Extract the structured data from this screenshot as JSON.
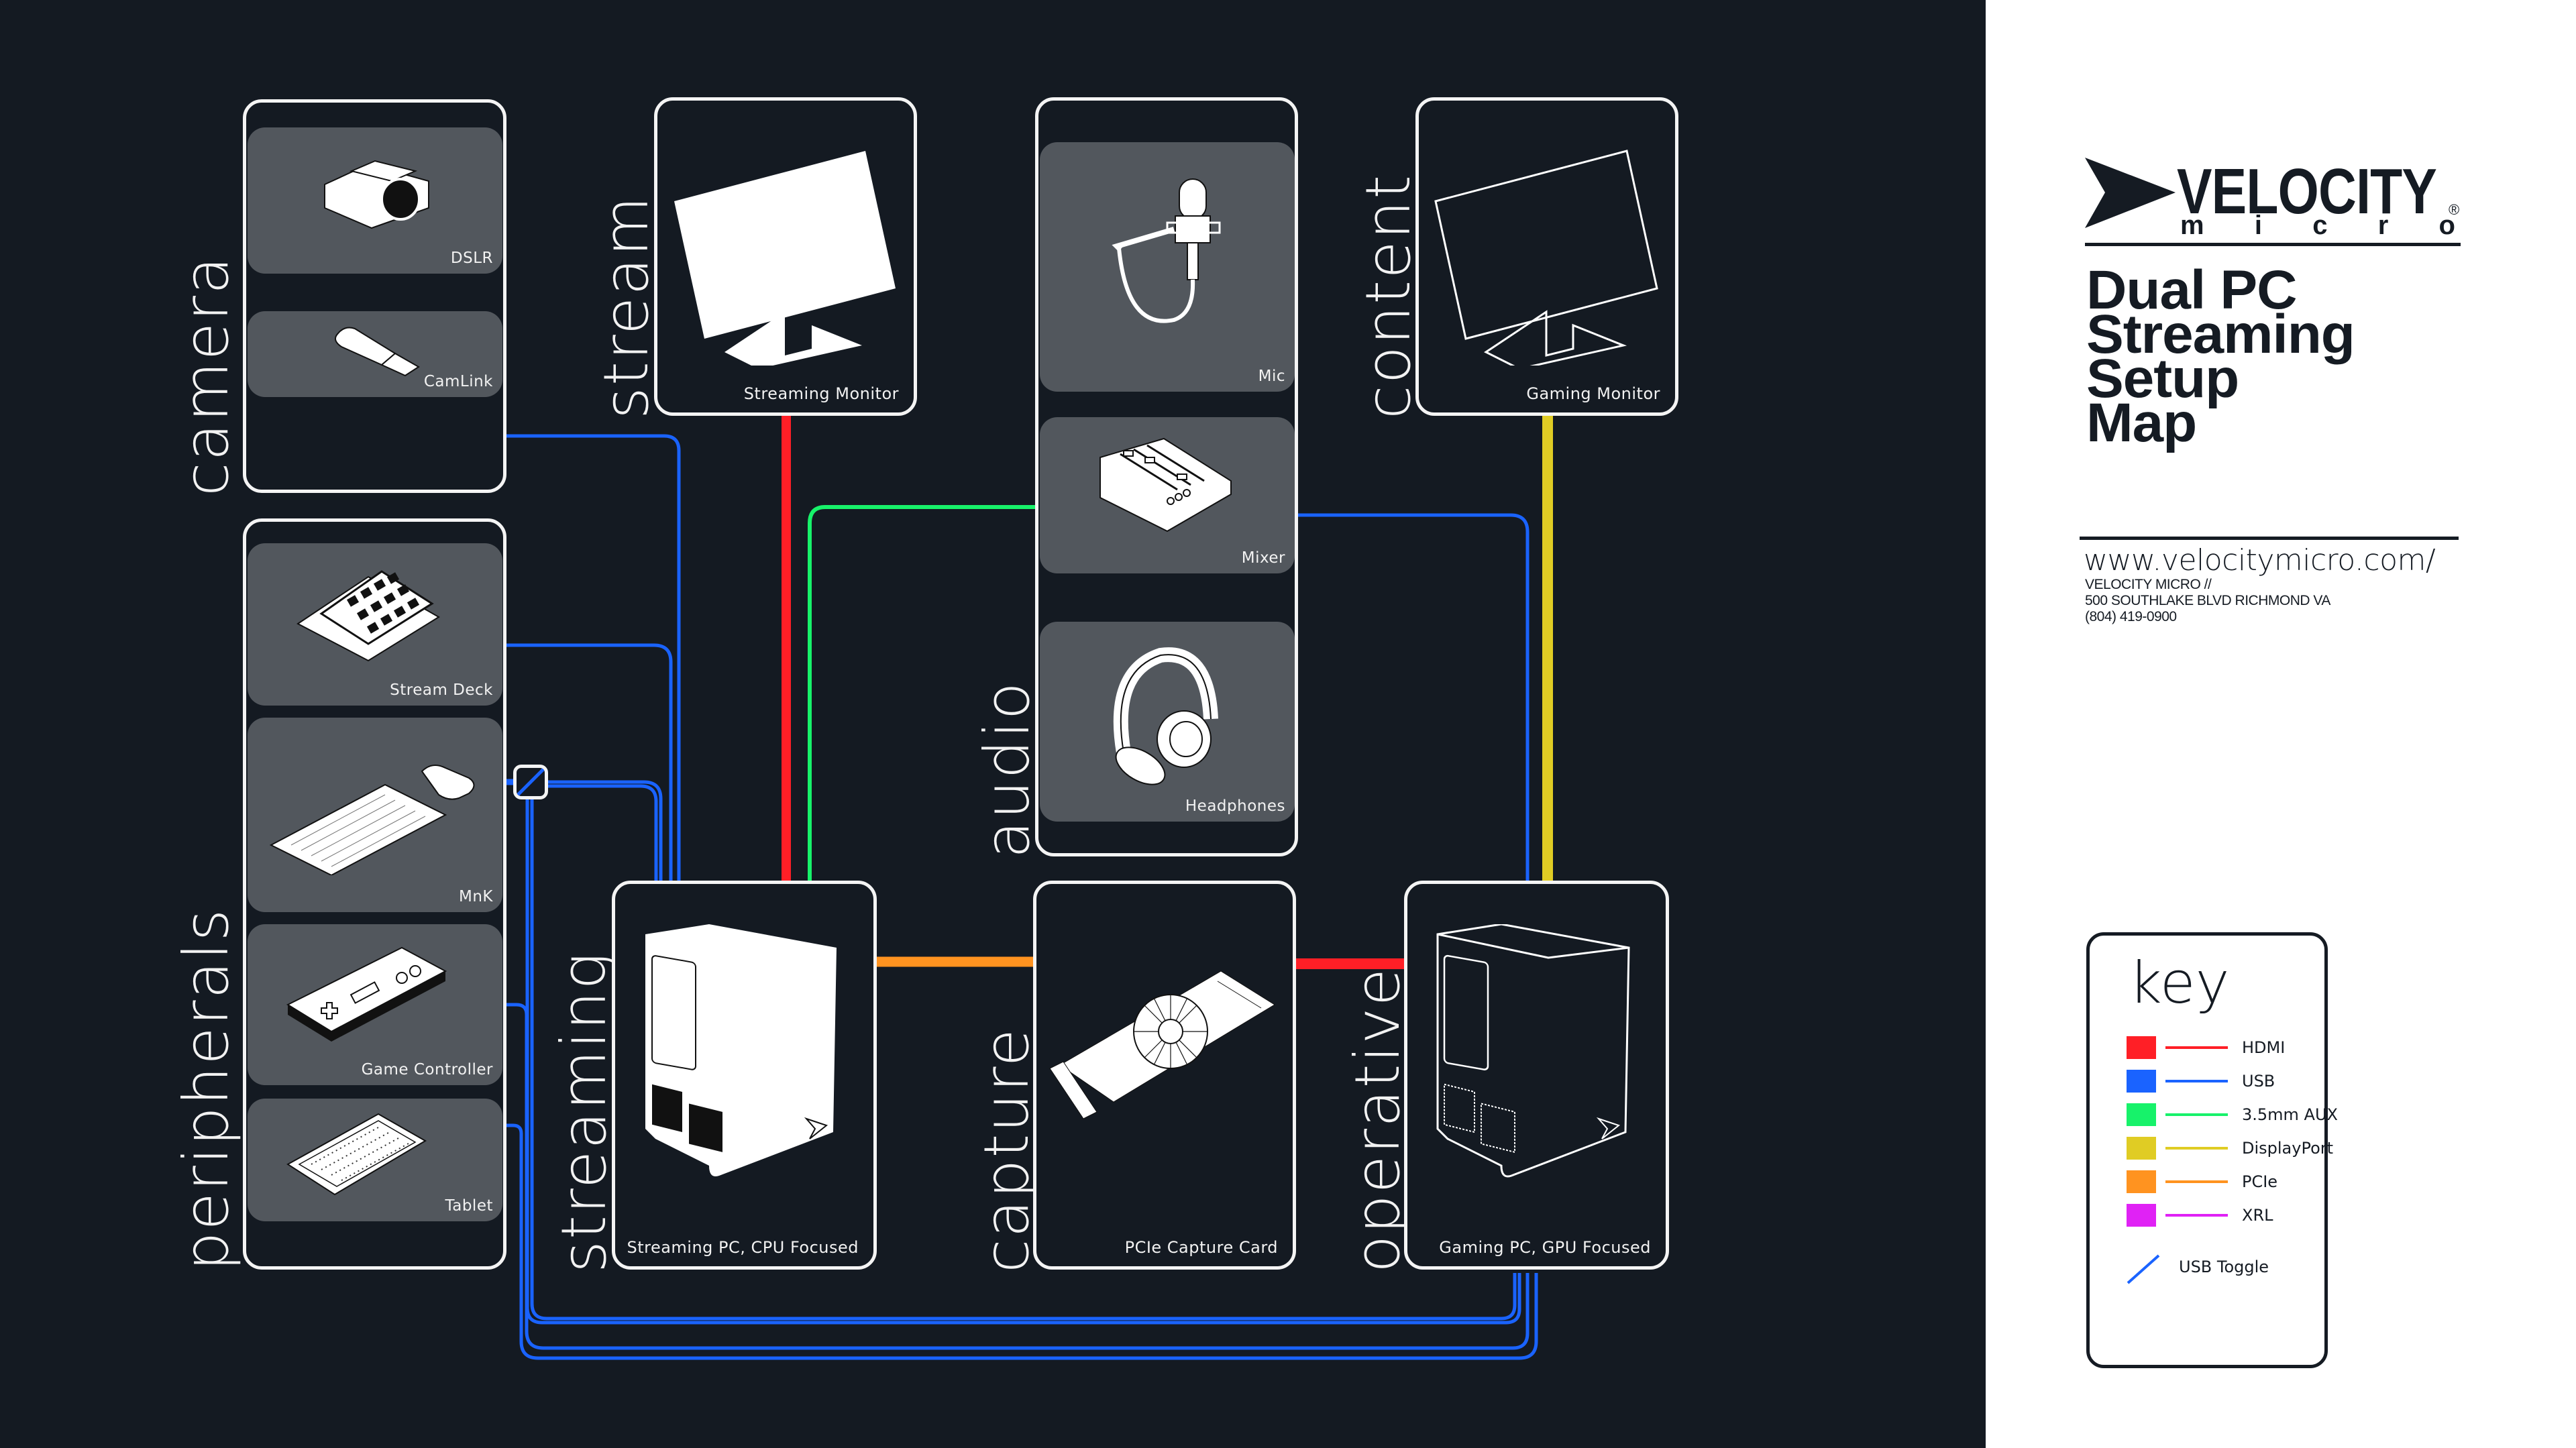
{
  "colors": {
    "background_dark": "#141a22",
    "panel_light": "#ffffff",
    "tile": "#52575d",
    "hdmi": "#ff1f26",
    "usb": "#1a63ff",
    "aux": "#17f26a",
    "displayport": "#e0cc24",
    "pcie": "#ff9320",
    "xrl": "#e022f5"
  },
  "groups": {
    "camera": {
      "label": "camera",
      "items": [
        "DSLR",
        "CamLink"
      ]
    },
    "peripherals": {
      "label": "peripherals",
      "items": [
        "Stream Deck",
        "MnK",
        "Game Controller",
        "Tablet"
      ]
    },
    "stream": {
      "label": "stream",
      "device": "Streaming Monitor"
    },
    "audio": {
      "label": "audio",
      "items": [
        "Mic",
        "Mixer",
        "Headphones"
      ]
    },
    "content": {
      "label": "content",
      "device": "Gaming Monitor"
    },
    "streaming": {
      "label": "streaming",
      "device": "Streaming PC, CPU Focused"
    },
    "capture": {
      "label": "capture",
      "device": "PCIe Capture Card"
    },
    "operative": {
      "label": "operative",
      "device": "Gaming PC, GPU Focused"
    }
  },
  "connections": [
    {
      "from": "DSLR",
      "to": "CamLink",
      "type": "HDMI"
    },
    {
      "from": "CamLink",
      "to": "Streaming PC, CPU Focused",
      "type": "USB"
    },
    {
      "from": "Stream Deck",
      "to": "Streaming PC, CPU Focused",
      "type": "USB"
    },
    {
      "from": "MnK",
      "to": "USB Toggle",
      "type": "USB"
    },
    {
      "from": "USB Toggle",
      "to": "Streaming PC, CPU Focused",
      "type": "USB"
    },
    {
      "from": "USB Toggle",
      "to": "Gaming PC, GPU Focused",
      "type": "USB"
    },
    {
      "from": "Game Controller",
      "to": "Gaming PC, GPU Focused",
      "type": "USB"
    },
    {
      "from": "Tablet",
      "to": "Gaming PC, GPU Focused",
      "type": "USB"
    },
    {
      "from": "Streaming Monitor",
      "to": "Streaming PC, CPU Focused",
      "type": "HDMI"
    },
    {
      "from": "Mic",
      "to": "Mixer",
      "type": "XRL"
    },
    {
      "from": "Mixer",
      "to": "Headphones",
      "type": "3.5mm AUX"
    },
    {
      "from": "Mixer",
      "to": "Streaming PC, CPU Focused",
      "type": "3.5mm AUX"
    },
    {
      "from": "Mixer",
      "to": "Gaming PC, GPU Focused",
      "type": "USB"
    },
    {
      "from": "Gaming Monitor",
      "to": "Gaming PC, GPU Focused",
      "type": "DisplayPort"
    },
    {
      "from": "Streaming PC, CPU Focused",
      "to": "PCIe Capture Card",
      "type": "PCIe"
    },
    {
      "from": "PCIe Capture Card",
      "to": "Gaming PC, GPU Focused",
      "type": "HDMI"
    }
  ],
  "brand": {
    "name": "VELOCITY",
    "sub": "micro",
    "reg": "®",
    "title_lines": [
      "Dual PC",
      "Streaming",
      "Setup",
      "Map"
    ],
    "url": "www.velocitymicro.com/",
    "address_lines": [
      "VELOCITY MICRO //",
      "500 SOUTHLAKE BLVD RICHMOND VA",
      "(804) 419-0900"
    ]
  },
  "key": {
    "title": "key",
    "entries": [
      {
        "label": "HDMI",
        "color": "#ff1f26"
      },
      {
        "label": "USB",
        "color": "#1a63ff"
      },
      {
        "label": "3.5mm AUX",
        "color": "#17f26a"
      },
      {
        "label": "DisplayPort",
        "color": "#e0cc24"
      },
      {
        "label": "PCIe",
        "color": "#ff9320"
      },
      {
        "label": "XRL",
        "color": "#e022f5"
      }
    ],
    "toggle_label": "USB Toggle"
  }
}
